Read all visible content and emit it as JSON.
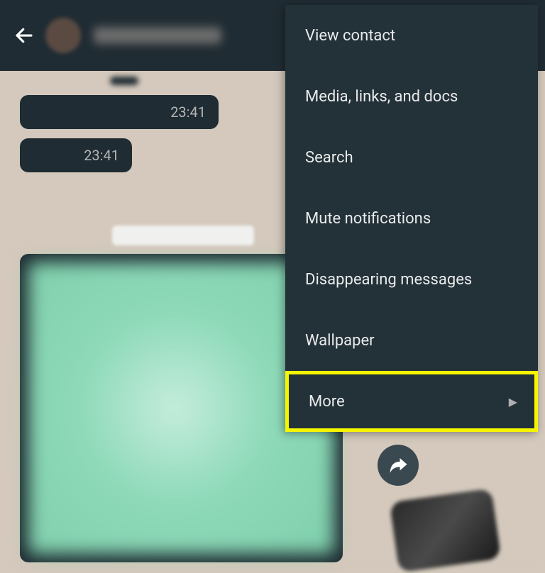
{
  "header": {
    "contact_name": ""
  },
  "chat": {
    "bubble1_time": "23:41",
    "bubble2_time": "23:41"
  },
  "menu": {
    "items": [
      {
        "label": "View contact"
      },
      {
        "label": "Media, links, and docs"
      },
      {
        "label": "Search"
      },
      {
        "label": "Mute notifications"
      },
      {
        "label": "Disappearing messages"
      },
      {
        "label": "Wallpaper"
      },
      {
        "label": "More"
      }
    ]
  }
}
